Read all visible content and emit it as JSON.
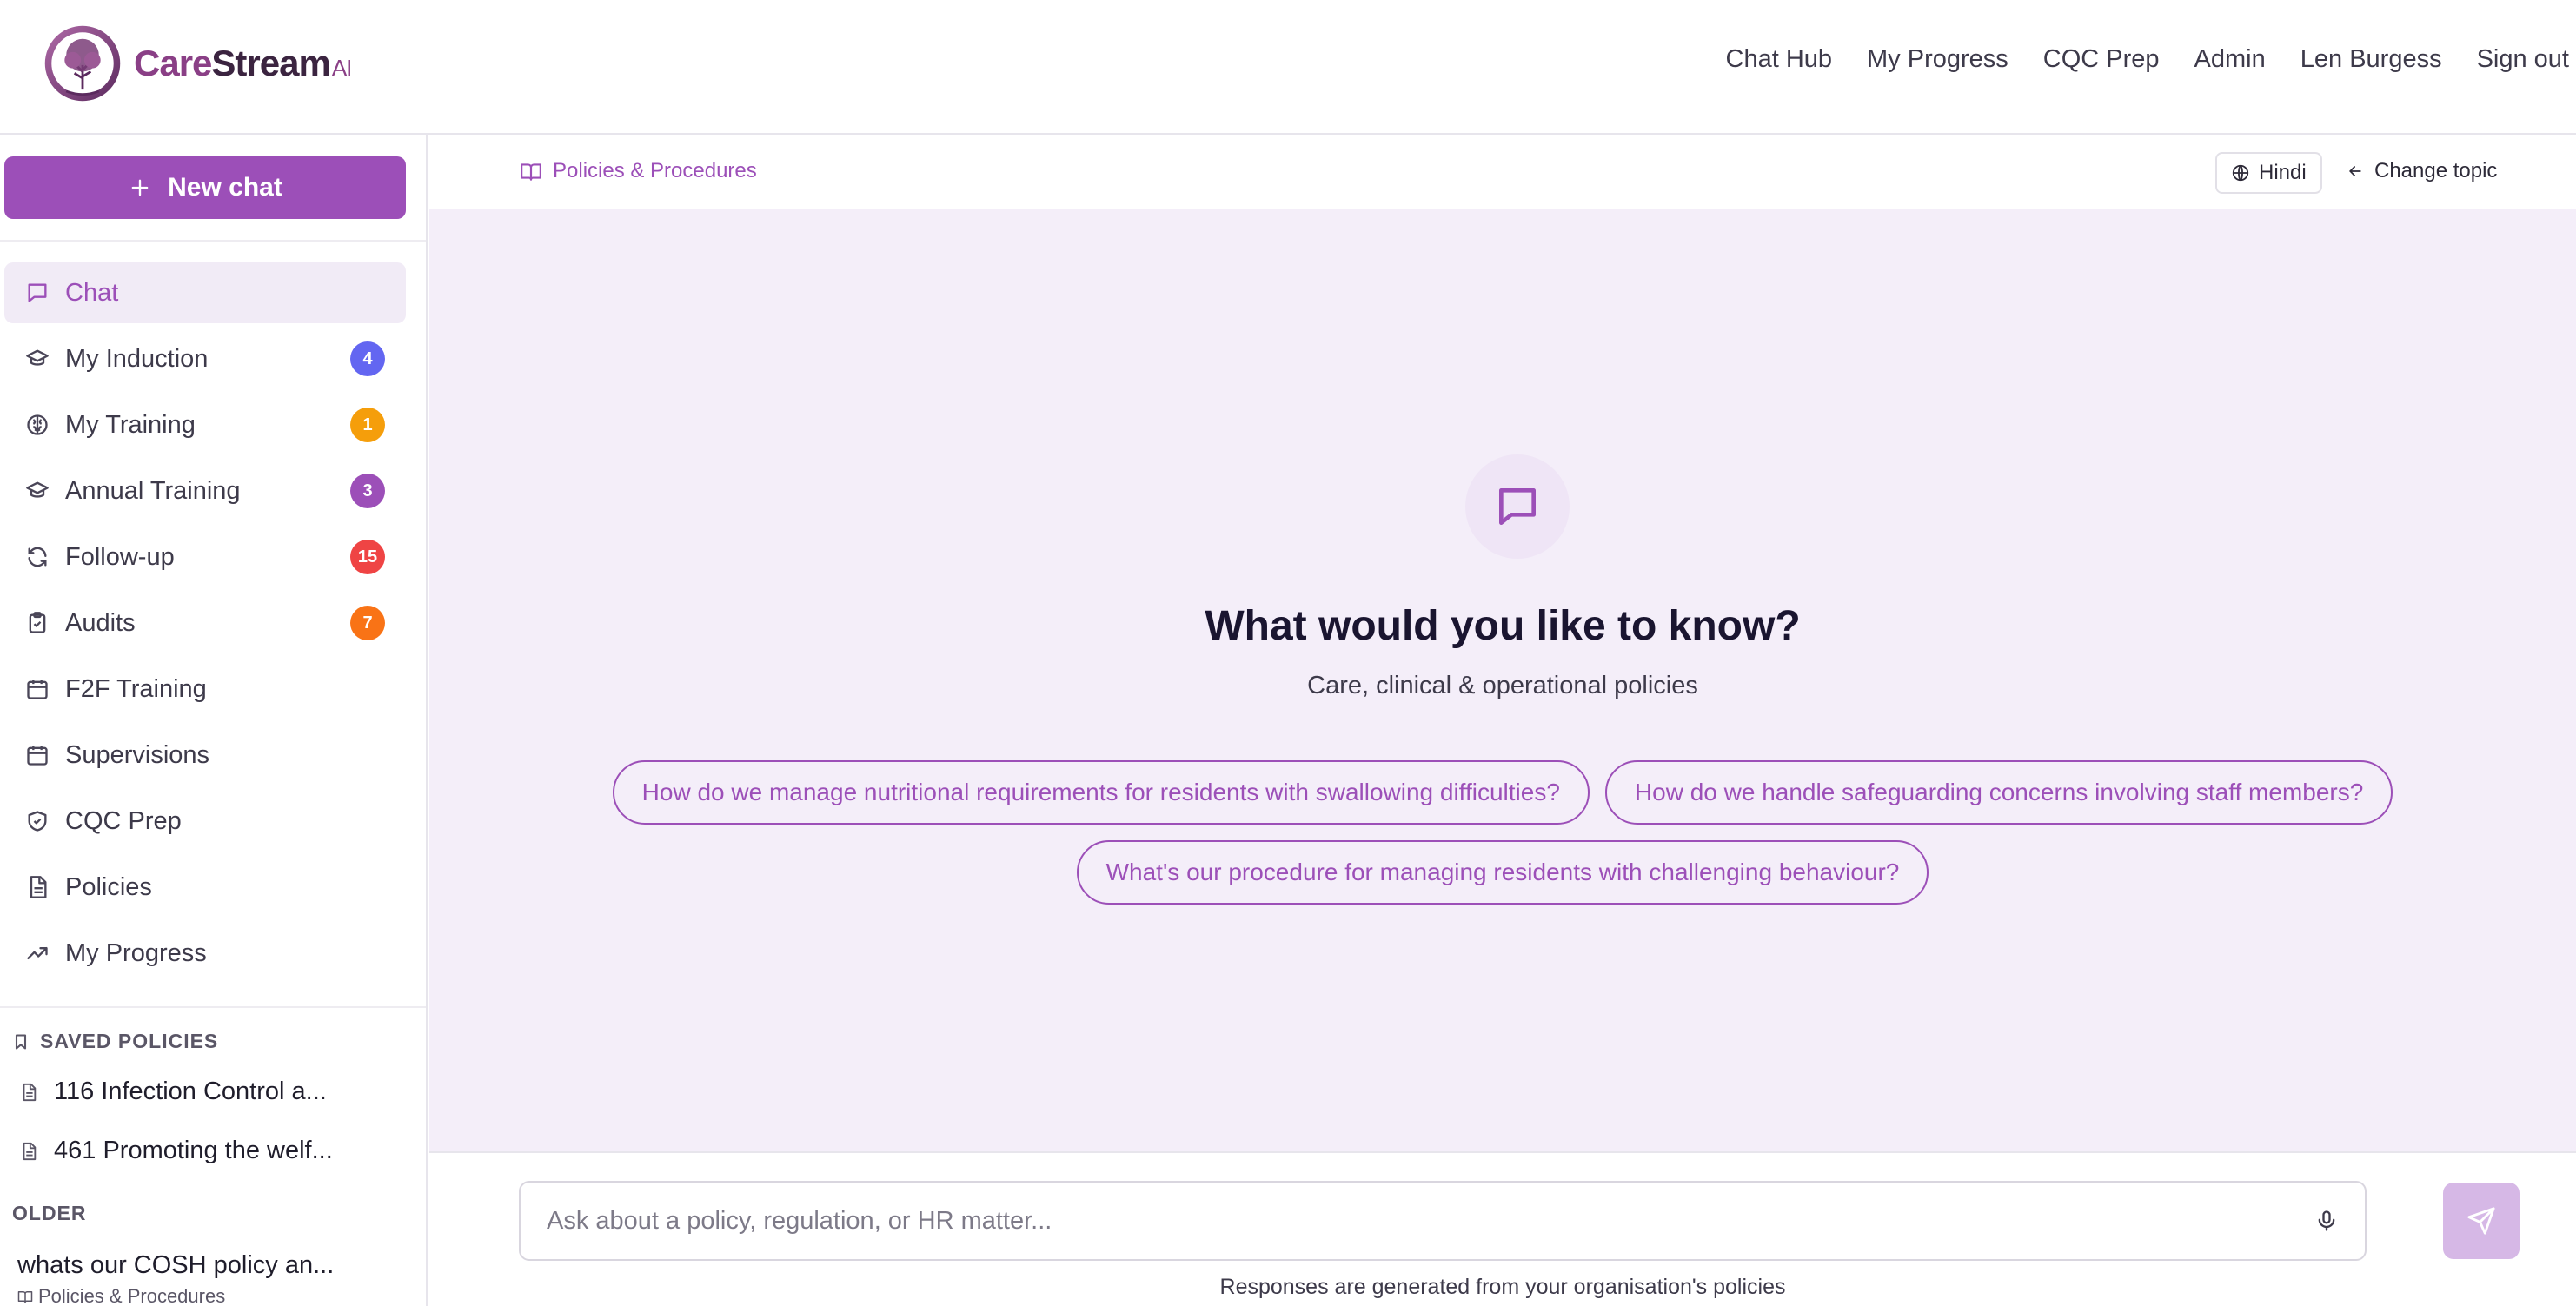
{
  "brand": {
    "name_part1": "Care",
    "name_part2": "Stream",
    "suffix": "AI",
    "accent": "#9c4fb8"
  },
  "topnav": [
    "Chat Hub",
    "My Progress",
    "CQC Prep",
    "Admin",
    "Len Burgess",
    "Sign out"
  ],
  "sidebar": {
    "new_chat_label": "New chat",
    "items": [
      {
        "label": "Chat",
        "icon": "chat-icon",
        "active": true
      },
      {
        "label": "My Induction",
        "icon": "graduation-cap-icon",
        "badge": "4",
        "badge_color": "#6366f1"
      },
      {
        "label": "My Training",
        "icon": "brain-icon",
        "badge": "1",
        "badge_color": "#f59e0b"
      },
      {
        "label": "Annual Training",
        "icon": "graduation-cap-icon",
        "badge": "3",
        "badge_color": "#9c4fb8"
      },
      {
        "label": "Follow-up",
        "icon": "refresh-icon",
        "badge": "15",
        "badge_color": "#ef4444"
      },
      {
        "label": "Audits",
        "icon": "clipboard-check-icon",
        "badge": "7",
        "badge_color": "#f97316"
      },
      {
        "label": "F2F Training",
        "icon": "calendar-icon"
      },
      {
        "label": "Supervisions",
        "icon": "calendar-icon"
      },
      {
        "label": "CQC Prep",
        "icon": "shield-check-icon"
      },
      {
        "label": "Policies",
        "icon": "document-icon"
      },
      {
        "label": "My Progress",
        "icon": "trending-up-icon"
      }
    ],
    "saved_heading": "SAVED POLICIES",
    "saved": [
      "116 Infection Control a...",
      "461 Promoting the welf..."
    ],
    "older_heading": "OLDER",
    "older": [
      {
        "title": "whats our COSH policy an...",
        "topic": "Policies & Procedures"
      }
    ]
  },
  "main": {
    "topic_label": "Policies & Procedures",
    "language_label": "Hindi",
    "change_topic_label": "Change topic",
    "hero_title": "What would you like to know?",
    "hero_subtitle": "Care, clinical & operational policies",
    "suggestions": [
      "How do we manage nutritional requirements for residents with swallowing difficulties?",
      "How do we handle safeguarding concerns involving staff members?",
      "What's our procedure for managing residents with challenging behaviour?"
    ],
    "input_placeholder": "Ask about a policy, regulation, or HR matter...",
    "input_value": "",
    "footnote": "Responses are generated from your organisation's policies"
  }
}
